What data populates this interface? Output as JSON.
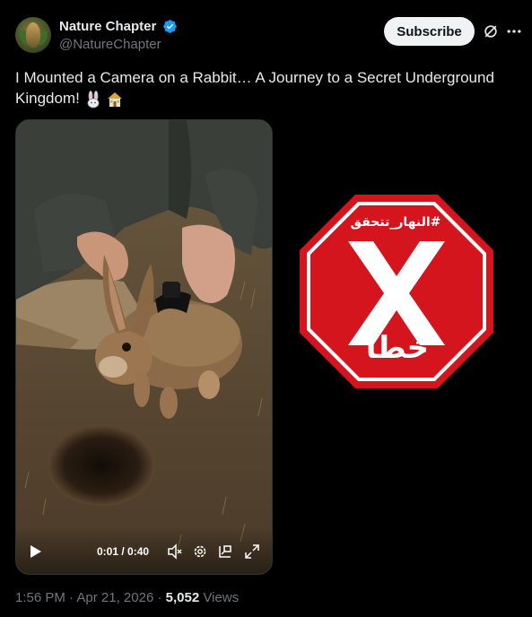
{
  "author": {
    "name": "Nature Chapter",
    "handle": "@NatureChapter",
    "verified": true,
    "avatar_icon": "nature-logo-icon"
  },
  "actions": {
    "subscribe_label": "Subscribe",
    "grok_icon": "grok-icon",
    "more_icon": "more-icon"
  },
  "post": {
    "text": "I Mounted a Camera on a Rabbit… A Journey to a Secret Underground Kingdom!",
    "emojis": [
      "rabbit-emoji",
      "house-emoji"
    ]
  },
  "video": {
    "time": "0:01 / 0:40",
    "controls": [
      "play-icon",
      "mute-icon",
      "settings-icon",
      "pip-icon",
      "fullscreen-icon"
    ]
  },
  "fact_check": {
    "hashtag": "#النهار_تتحقق",
    "verdict": "خطأ",
    "color": "#d4151d"
  },
  "meta": {
    "time": "1:56 PM",
    "separator1": " · ",
    "date": "Apr 21, 2026",
    "separator2": " · ",
    "views": "5,052",
    "views_label": " Views"
  },
  "colors": {
    "background": "#000000",
    "text": "#e7e9ea",
    "secondary": "#71767b",
    "verified": "#1d9bf0"
  }
}
